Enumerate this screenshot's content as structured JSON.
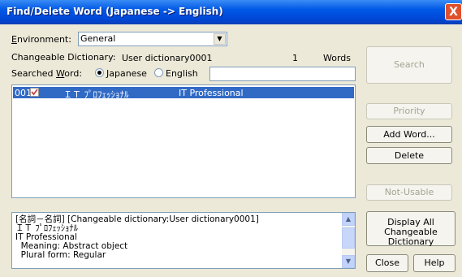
{
  "window": {
    "title": "Find/Delete Word (Japanese -> English)",
    "close_glyph": "X"
  },
  "environment": {
    "label": "Environment:",
    "value": "General"
  },
  "dictionary": {
    "label": "Changeable Dictionary:",
    "name": "User dictionary0001",
    "count": "1",
    "unit": "Words"
  },
  "searched": {
    "label": "Searched Word:",
    "option_japanese": "Japanese",
    "option_english": "English",
    "selected": "Japanese",
    "value": ""
  },
  "results": [
    {
      "id": "001",
      "japanese": "ＩＴ ﾌﾟﾛﾌｪｯｼｮﾅﾙ",
      "english": "IT Professional",
      "checked": true
    }
  ],
  "detail_lines": [
    "[名詞－名詞] [Changeable dictionary:User dictionary0001]",
    "ＩＴ ﾌﾟﾛﾌｪｯｼｮﾅﾙ",
    "IT Professional",
    "  Meaning: Abstract object",
    "  Plural form: Regular"
  ],
  "buttons": {
    "search": "Search",
    "priority": "Priority",
    "add_word": "Add Word...",
    "delete": "Delete",
    "not_usable": "Not-Usable",
    "display_all_1": "Display All",
    "display_all_2": "Changeable Dictionary",
    "close": "Close",
    "help": "Help"
  },
  "colors": {
    "titlebar": "#0058e6",
    "selection": "#316ac5",
    "face": "#ece9d8"
  }
}
